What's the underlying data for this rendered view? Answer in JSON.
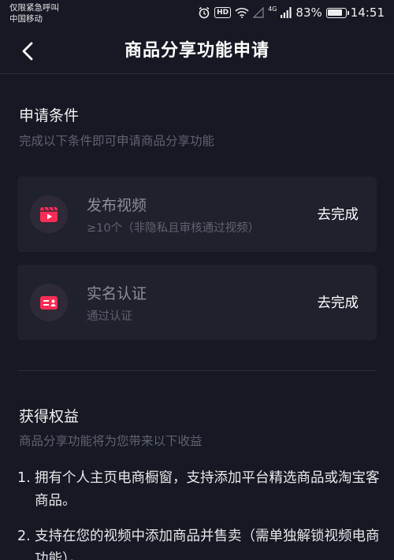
{
  "status_bar": {
    "carrier_line1": "仅限紧急呼叫",
    "carrier_line2": "中国移动",
    "hd": "HD",
    "network": "4G",
    "battery": "83%",
    "battery_level": 0.83,
    "time": "14:51"
  },
  "nav": {
    "title": "商品分享功能申请"
  },
  "conditions": {
    "title": "申请条件",
    "subtitle": "完成以下条件即可申请商品分享功能",
    "items": [
      {
        "title": "发布视频",
        "subtitle": "≥10个（非隐私且审核通过视频）",
        "action": "去完成",
        "icon": "video-icon"
      },
      {
        "title": "实名认证",
        "subtitle": "通过认证",
        "action": "去完成",
        "icon": "id-card-icon"
      }
    ]
  },
  "benefits": {
    "title": "获得权益",
    "subtitle": "商品分享功能将为您带来以下收益",
    "items": [
      {
        "num": "1.",
        "text": "拥有个人主页电商橱窗，支持添加平台精选商品或淘宝客商品。"
      },
      {
        "num": "2.",
        "text": "支持在您的视频中添加商品并售卖（需单独解锁视频电商功能）。"
      }
    ]
  },
  "colors": {
    "background": "#161823",
    "card": "#1f212c",
    "accent": "#fe2c55"
  }
}
